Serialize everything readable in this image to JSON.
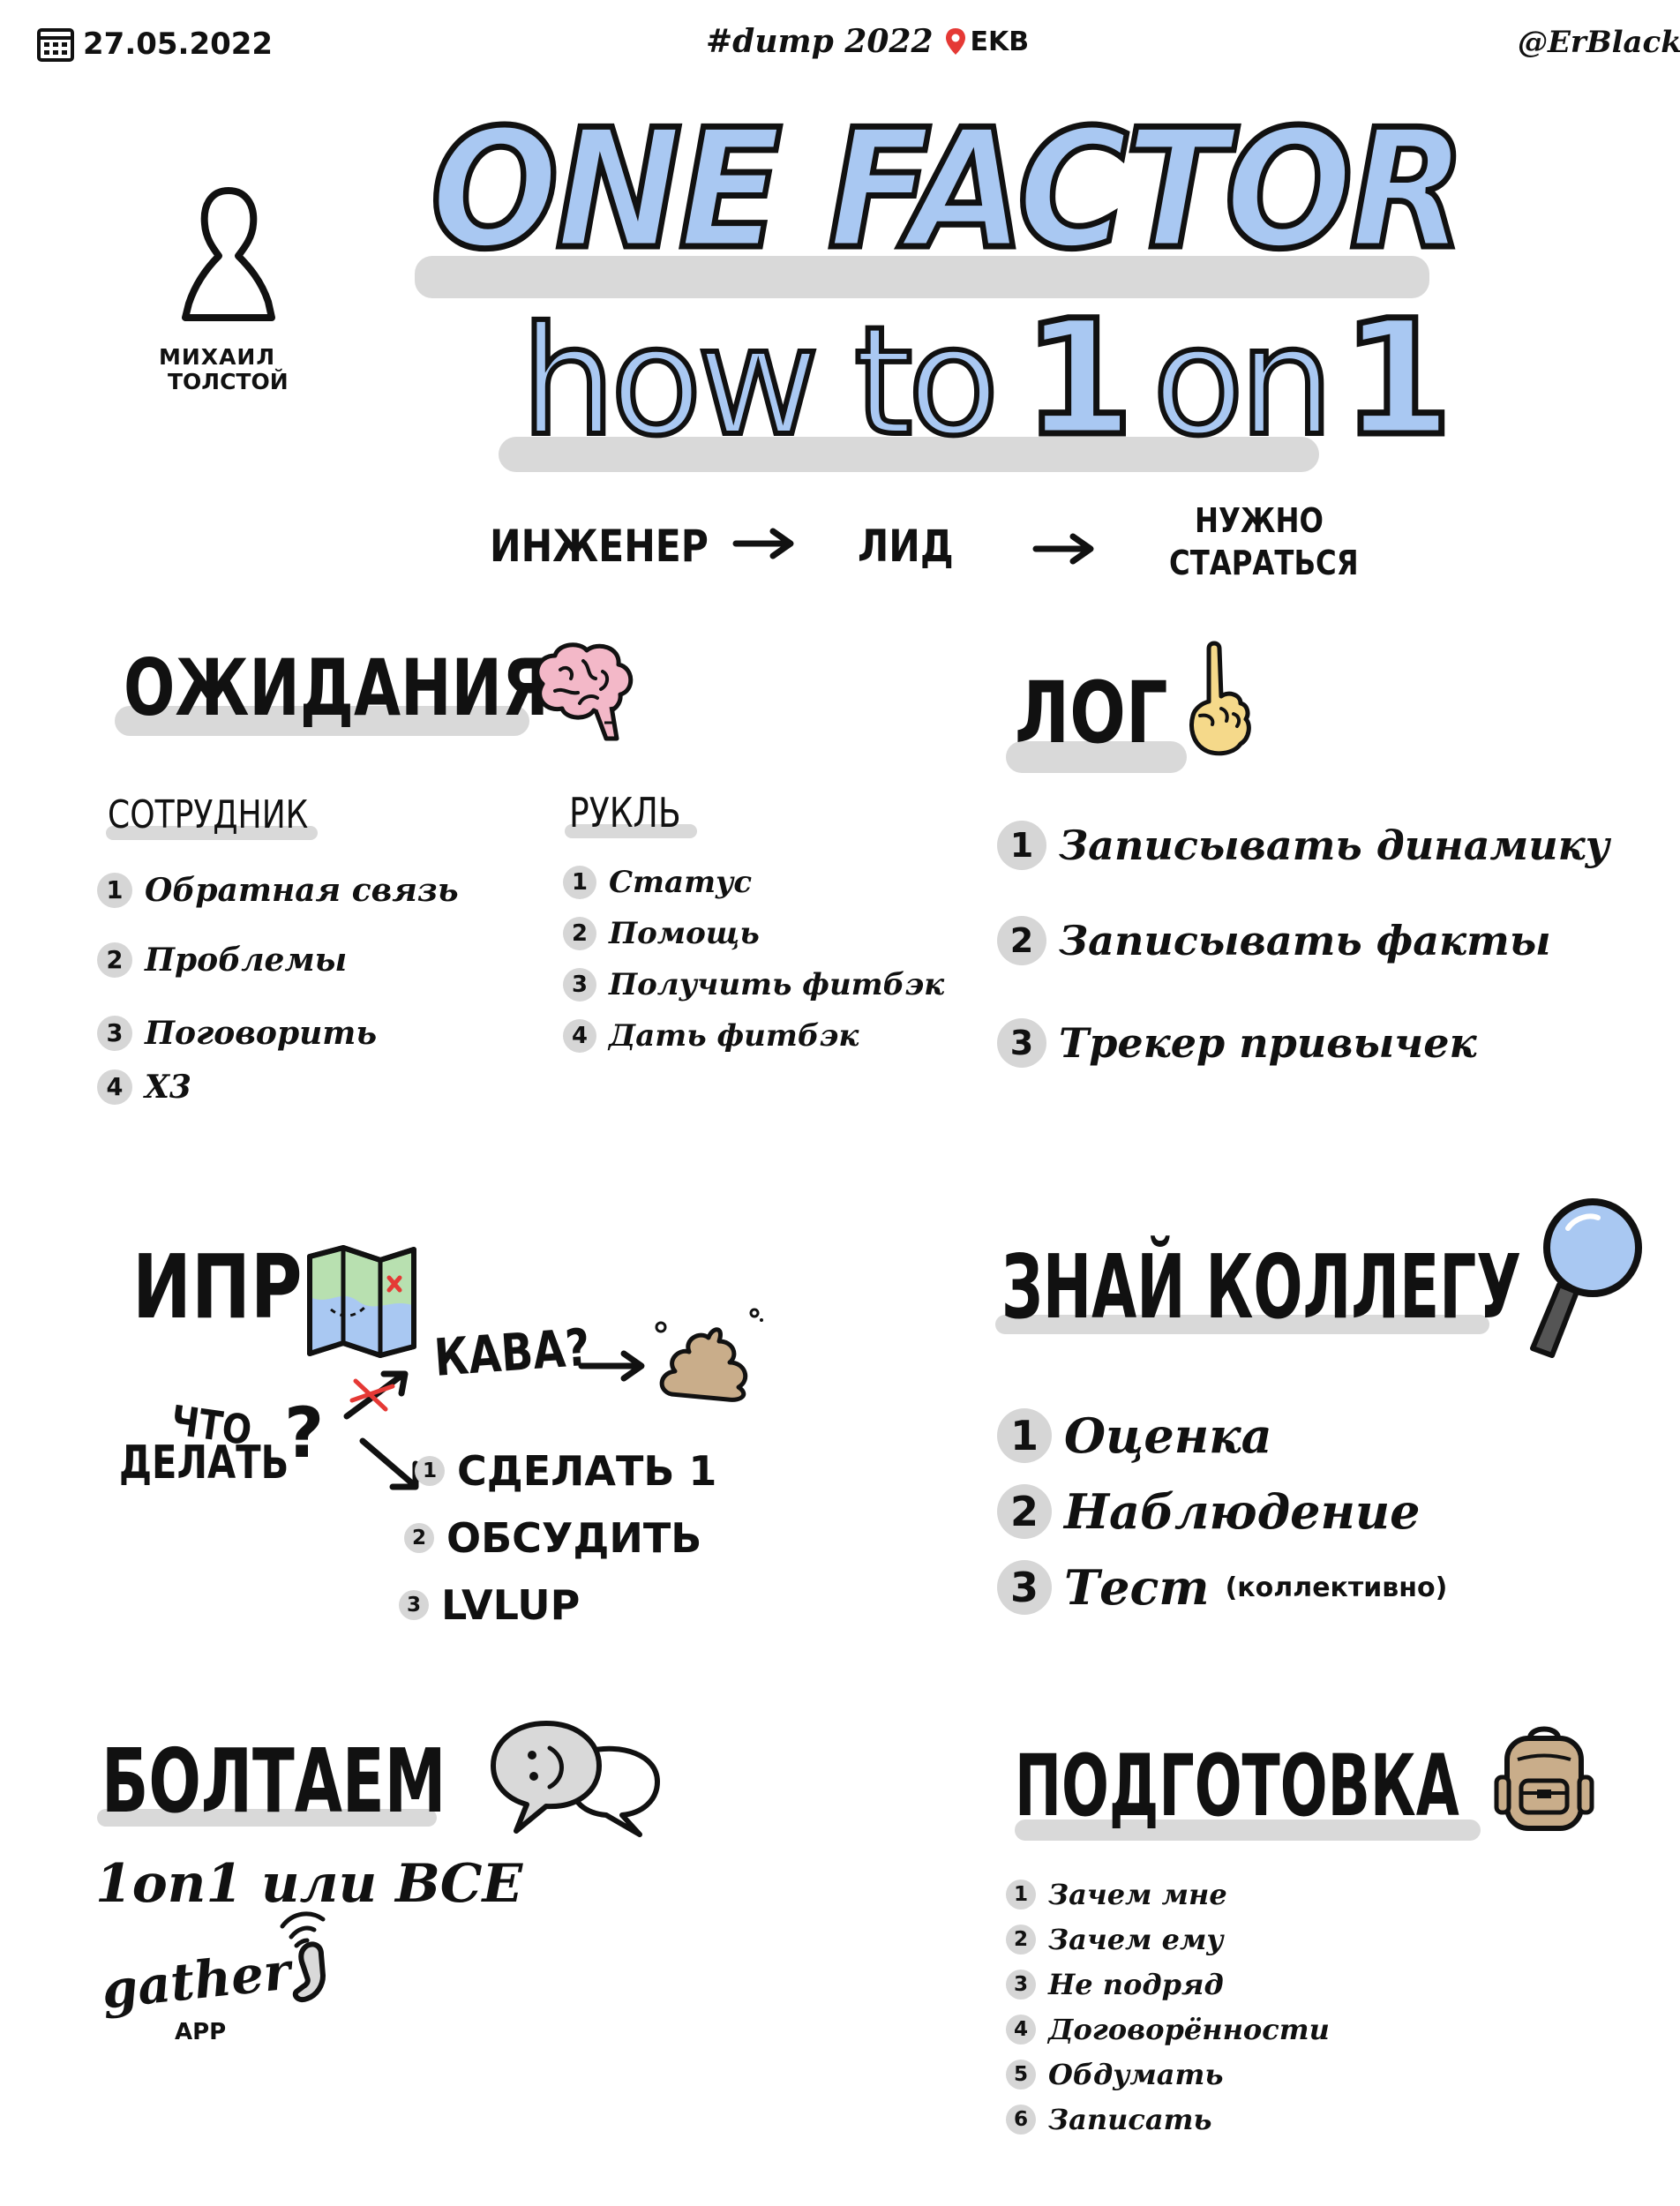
{
  "header": {
    "date": "27.05.2022",
    "event": "#dump 2022",
    "location": "EKB",
    "author_handle": "@ErBlack"
  },
  "speaker": {
    "name_line1": "МИХАИЛ",
    "name_line2": "ТОЛСТОЙ"
  },
  "title": {
    "main": "ONE FACTOR",
    "sub_how": "how",
    "sub_to": "to",
    "sub_one_a": "1",
    "sub_on": "on",
    "sub_one_b": "1"
  },
  "flow": {
    "step1": "ИНЖЕНЕР",
    "step2": "ЛИД",
    "step3_line1": "НУЖНО",
    "step3_line2": "СТАРАТЬСЯ"
  },
  "expectations": {
    "heading": "ОЖИДАНИЯ",
    "employee": {
      "heading": "СОТРУДНИК",
      "items": [
        {
          "n": "1",
          "text": "Обратная связь"
        },
        {
          "n": "2",
          "text": "Проблемы"
        },
        {
          "n": "3",
          "text": "Поговорить"
        },
        {
          "n": "4",
          "text": "Х3"
        }
      ]
    },
    "manager": {
      "heading": "РУКЛЬ",
      "items": [
        {
          "n": "1",
          "text": "Статус"
        },
        {
          "n": "2",
          "text": "Помощь"
        },
        {
          "n": "3",
          "text": "Получить фитбэк"
        },
        {
          "n": "4",
          "text": "Дать фитбэк"
        }
      ]
    }
  },
  "log": {
    "heading": "ЛОГ",
    "items": [
      {
        "n": "1",
        "text": "Записывать динамику"
      },
      {
        "n": "2",
        "text": "Записывать факты"
      },
      {
        "n": "3",
        "text": "Трекер привычек"
      }
    ]
  },
  "ipr": {
    "heading": "ИПР",
    "question_line1": "ЧТО",
    "question_line2": "ДЕЛАТЬ",
    "question_mark": "?",
    "kaba": "КАВА?",
    "items": [
      {
        "n": "1",
        "text": "СДЕЛАТЬ 1"
      },
      {
        "n": "2",
        "text": "ОБСУДИТЬ"
      },
      {
        "n": "3",
        "text": "LVLUP"
      }
    ]
  },
  "know_colleague": {
    "heading": "ЗНАЙ КОЛЛЕГУ",
    "items": [
      {
        "n": "1",
        "text": "Оценка",
        "note": ""
      },
      {
        "n": "2",
        "text": "Наблюдение",
        "note": ""
      },
      {
        "n": "3",
        "text": "Тест",
        "note": "(коллективно)"
      }
    ]
  },
  "chat": {
    "heading": "БОЛТАЕМ",
    "line": "1on1 или ВСЕ",
    "app_name": "gather",
    "app_suffix": "APP"
  },
  "prep": {
    "heading": "ПОДГОТОВКА",
    "items": [
      {
        "n": "1",
        "text": "Зачем мне"
      },
      {
        "n": "2",
        "text": "Зачем ему"
      },
      {
        "n": "3",
        "text": "Не подряд"
      },
      {
        "n": "4",
        "text": "Договорённости"
      },
      {
        "n": "5",
        "text": "Обдумать"
      },
      {
        "n": "6",
        "text": "Записать"
      }
    ]
  },
  "colors": {
    "accent_blue": "#a9c8f2",
    "shadow_gray": "#d9d9d9",
    "ink": "#111111",
    "brain_pink": "#f3b8c8",
    "finger_yellow": "#f5d98a",
    "poop_brown": "#c9ad8a",
    "pin_red": "#e53935",
    "map_green": "#b8e0b0"
  }
}
